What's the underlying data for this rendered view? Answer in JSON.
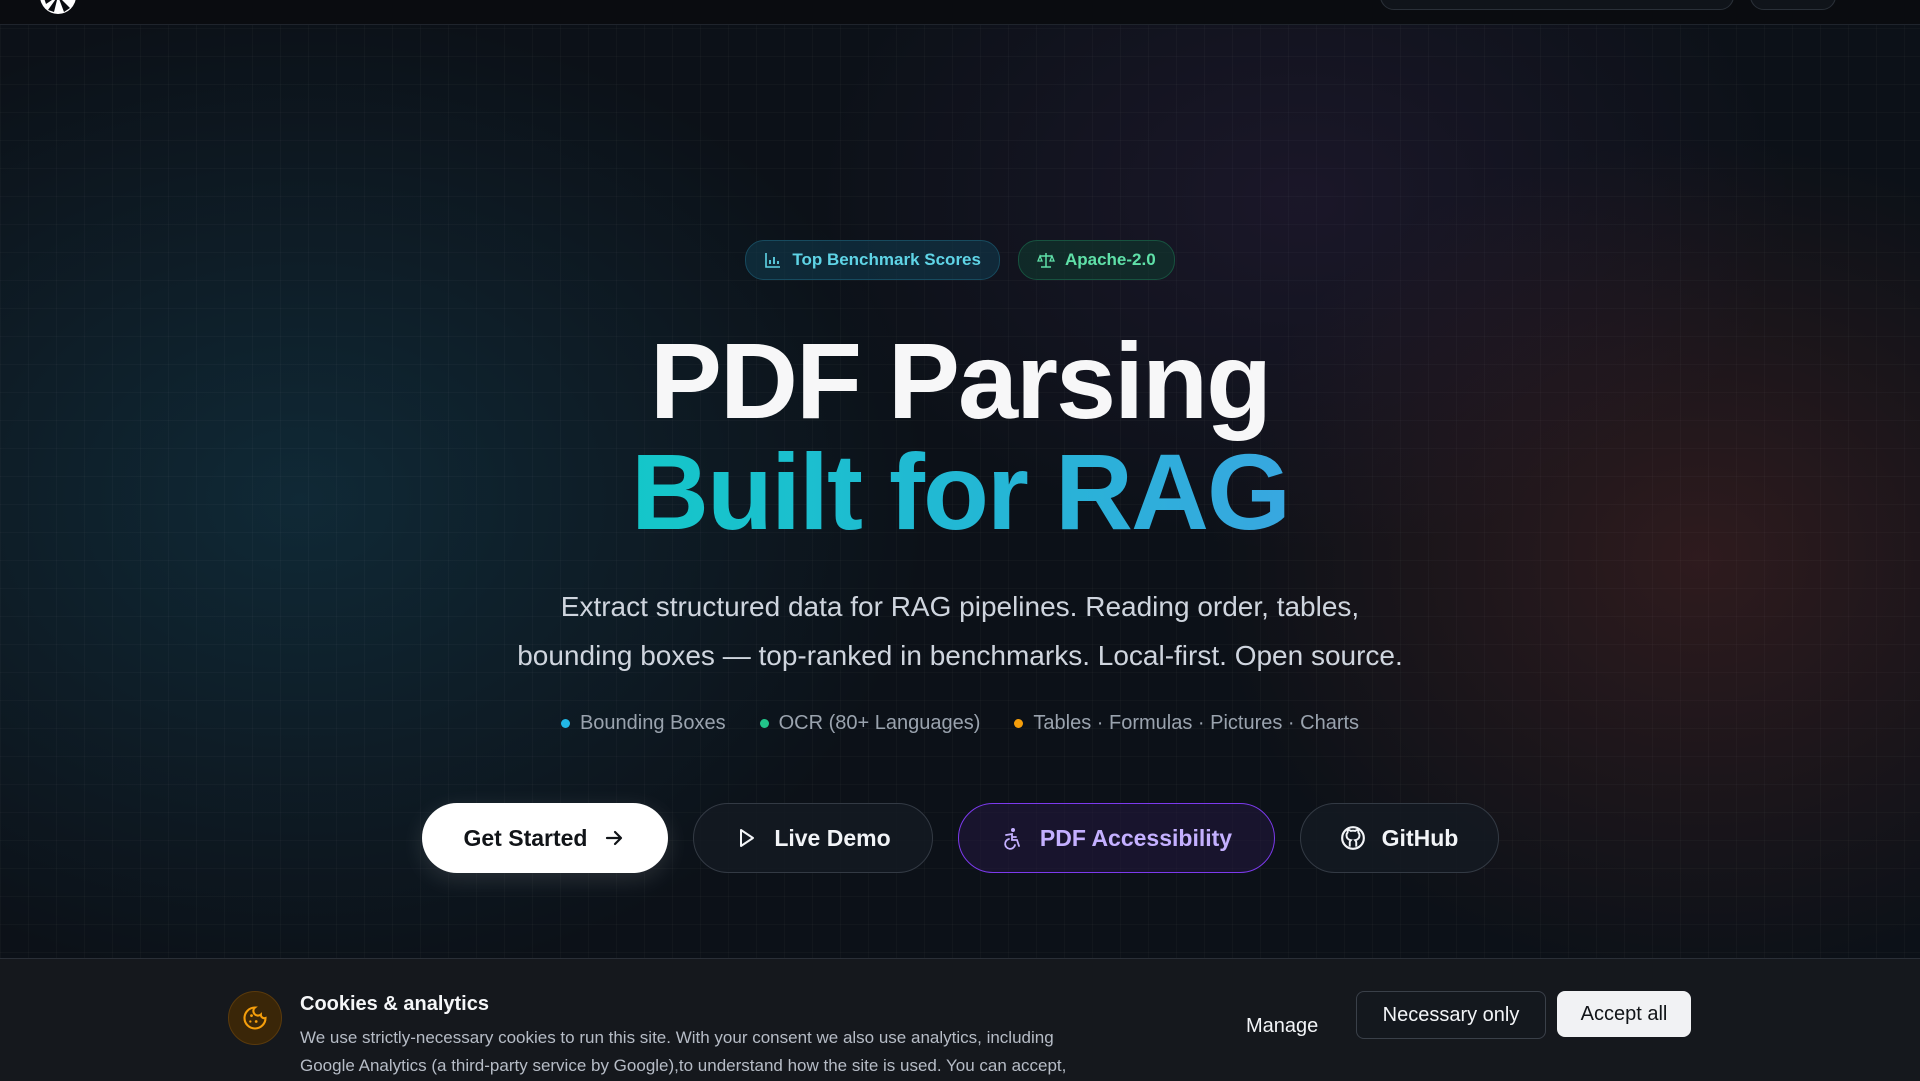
{
  "badges": [
    {
      "label": "Top Benchmark Scores",
      "icon": "bar-chart-icon",
      "color": "#5fd4e6"
    },
    {
      "label": "Apache-2.0",
      "icon": "scale-icon",
      "color": "#5fe0a8"
    }
  ],
  "hero": {
    "title_line1": "PDF Parsing",
    "title_line2": "Built for RAG",
    "subtitle_line1": "Extract structured data for RAG pipelines. Reading order, tables,",
    "subtitle_line2": "bounding boxes — top-ranked in benchmarks. Local-first. Open source."
  },
  "features": [
    {
      "label": "Bounding Boxes",
      "dot_color": "#22b8e6"
    },
    {
      "label": "OCR (80+ Languages)",
      "dot_color": "#22c58a"
    },
    {
      "label": "Tables · Formulas · Pictures · Charts",
      "dot_color": "#f59e0b"
    }
  ],
  "ctas": {
    "get_started": "Get Started",
    "live_demo": "Live Demo",
    "accessibility": "PDF Accessibility",
    "github": "GitHub"
  },
  "cookie": {
    "title": "Cookies & analytics",
    "text_line1": "We use strictly-necessary cookies to run this site. With your consent we also use analytics, including",
    "text_line2": "Google Analytics (a third-party service by Google),to understand how the site is used. You can accept,",
    "manage": "Manage",
    "necessary_only": "Necessary only",
    "accept_all": "Accept all"
  },
  "colors": {
    "accent_cyan": "#14c7c9",
    "accent_purple": "#7c3aed",
    "cookie_icon": "#f59e0b"
  }
}
